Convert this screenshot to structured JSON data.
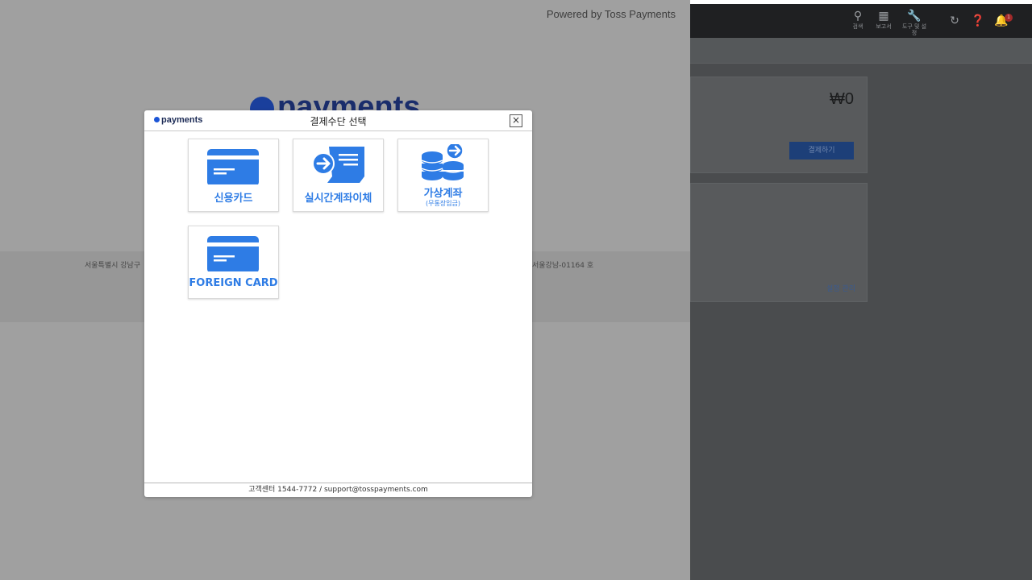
{
  "payment_window": {
    "powered_by": "Powered by Toss Payments",
    "brand_logo": "payments",
    "footer_left": "서울특별시 강남구",
    "footer_right": "서울강남-01164 호"
  },
  "dialog": {
    "logo": "payments",
    "title": "결제수단 선택",
    "close_label": "×",
    "methods": [
      {
        "label": "신용카드",
        "sub": "",
        "icon": "credit-card-icon"
      },
      {
        "label": "실시간계좌이체",
        "sub": "",
        "icon": "bank-transfer-icon"
      },
      {
        "label": "가상계좌",
        "sub": "(무통장입금)",
        "icon": "coins-icon"
      },
      {
        "label": "FOREIGN CARD",
        "sub": "",
        "icon": "credit-card-icon"
      }
    ],
    "footer": "고객센터 1544-7772 / support@tosspayments.com"
  },
  "background_app": {
    "topbar": [
      {
        "label": "검색",
        "icon": "search-icon"
      },
      {
        "label": "보고서",
        "icon": "report-icon"
      },
      {
        "label": "도구 및 설정",
        "icon": "wrench-icon"
      }
    ],
    "notification_count": "1",
    "amount": "₩0",
    "pay_button": "결제하기",
    "settings_link": "설정 관리"
  },
  "colors": {
    "accent": "#2e7ce5",
    "brand_dark": "#1b2a55"
  }
}
